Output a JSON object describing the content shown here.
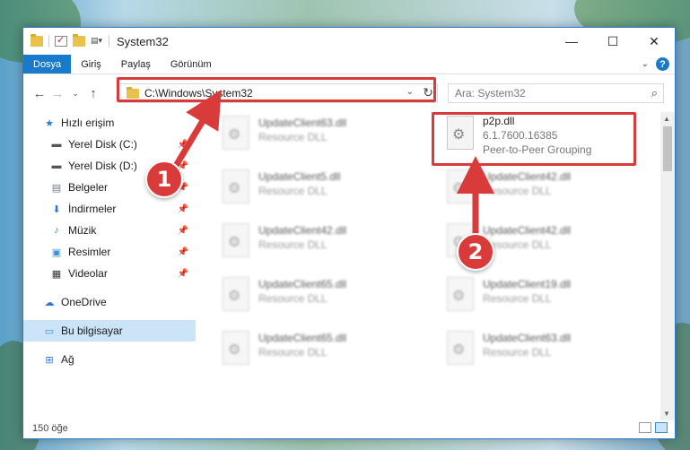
{
  "window": {
    "title": "System32",
    "controls": [
      "minimize-icon",
      "maximize-icon",
      "close-icon"
    ]
  },
  "ribbon": {
    "tabs": [
      {
        "label": "Dosya",
        "active": true
      },
      {
        "label": "Giriş",
        "active": false
      },
      {
        "label": "Paylaş",
        "active": false
      },
      {
        "label": "Görünüm",
        "active": false
      }
    ]
  },
  "address": {
    "path": "C:\\Windows\\System32",
    "search_placeholder": "Ara: System32"
  },
  "sidebar": {
    "items": [
      {
        "label": "Hızlı erişim",
        "icon": "star-icon",
        "pinned": false
      },
      {
        "label": "Yerel Disk (C:)",
        "icon": "drive-icon",
        "pinned": true
      },
      {
        "label": "Yerel Disk (D:)",
        "icon": "drive-icon",
        "pinned": true
      },
      {
        "label": "Belgeler",
        "icon": "document-icon",
        "pinned": true
      },
      {
        "label": "İndirmeler",
        "icon": "download-icon",
        "pinned": true
      },
      {
        "label": "Müzik",
        "icon": "music-icon",
        "pinned": true
      },
      {
        "label": "Resimler",
        "icon": "picture-icon",
        "pinned": true
      },
      {
        "label": "Videolar",
        "icon": "video-icon",
        "pinned": true
      },
      {
        "label": "OneDrive",
        "icon": "cloud-icon",
        "pinned": false
      },
      {
        "label": "Bu bilgisayar",
        "icon": "computer-icon",
        "pinned": false,
        "selected": true
      },
      {
        "label": "Ağ",
        "icon": "network-icon",
        "pinned": false
      }
    ]
  },
  "files": {
    "highlighted": {
      "name": "p2p.dll",
      "version": "6.1.7600.16385",
      "description": "Peer-to-Peer Grouping"
    },
    "left_column": [
      {
        "name": "UpdateClient63.dll",
        "type": "Resource DLL"
      },
      {
        "name": "UpdateClient5.dll",
        "type": "Resource DLL"
      },
      {
        "name": "UpdateClient42.dll",
        "type": "Resource DLL"
      },
      {
        "name": "UpdateClient65.dll",
        "type": "Resource DLL"
      },
      {
        "name": "UpdateClient65.dll",
        "type": "Resource DLL"
      }
    ],
    "right_column": [
      {
        "name": "UpdateClient42.dll",
        "type": "Resource DLL"
      },
      {
        "name": "UpdateClient42.dll",
        "type": "Resource DLL"
      },
      {
        "name": "UpdateClient19.dll",
        "type": "Resource DLL"
      },
      {
        "name": "UpdateClient63.dll",
        "type": "Resource DLL"
      }
    ]
  },
  "status": {
    "count": "150 öğe"
  },
  "annotations": {
    "badge1": "1",
    "badge2": "2",
    "accent": "#d93a3a"
  }
}
